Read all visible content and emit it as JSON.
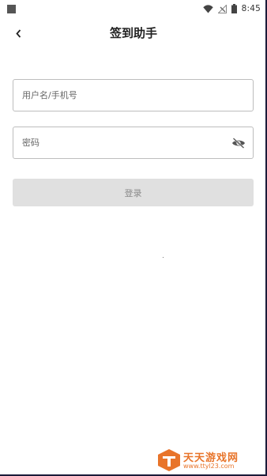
{
  "status_bar": {
    "time": "8:45"
  },
  "header": {
    "title": "签到助手"
  },
  "form": {
    "username_placeholder": "用户名/手机号",
    "password_placeholder": "密码",
    "login_label": "登录"
  },
  "watermark": {
    "name": "天天游戏网",
    "url": "www.ttyl23.com"
  },
  "icons": {
    "back": "chevron-left-icon",
    "password_toggle": "eye-off-icon",
    "wifi": "wifi-icon",
    "signal": "signal-icon",
    "battery": "battery-icon"
  },
  "colors": {
    "watermark_orange": "#e8742a",
    "button_disabled_bg": "#e0e0e0",
    "button_disabled_text": "#8a8a8a"
  }
}
